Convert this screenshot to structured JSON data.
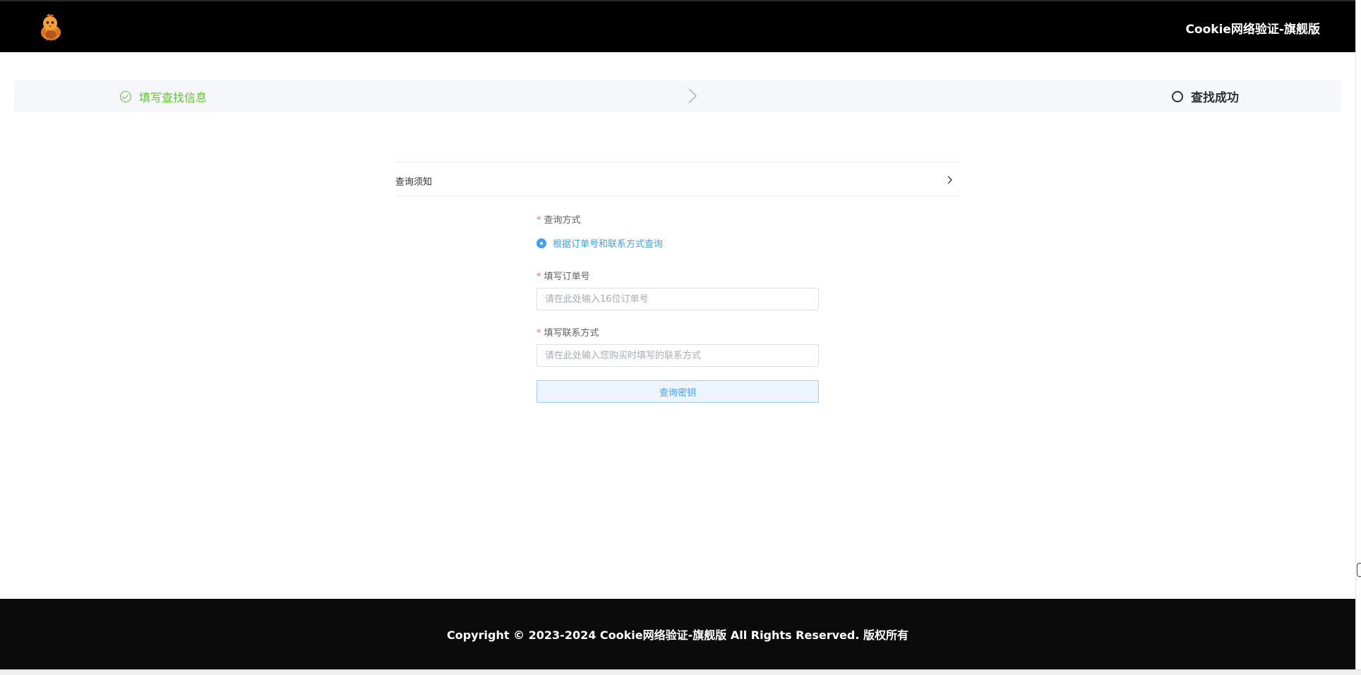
{
  "header": {
    "logo_icon": "chick-mascot-logo-icon",
    "title": "Cookie网络验证-旗舰版"
  },
  "steps": {
    "items": [
      {
        "label": "填写查找信息",
        "status": "done",
        "color": "#67c23a",
        "icon": "circle-check-icon"
      },
      {
        "label": "查找成功",
        "status": "pending",
        "color": "#303133",
        "icon": "circle-outline-icon"
      }
    ],
    "separator_icon": "chevron-right-icon"
  },
  "notice": {
    "title": "查询须知",
    "expand_icon": "chevron-right-icon"
  },
  "form": {
    "required_mark": "*",
    "query_method": {
      "label": "查询方式",
      "options": [
        "根据订单号和联系方式查询"
      ],
      "selected": "根据订单号和联系方式查询"
    },
    "order_no": {
      "label": "填写订单号",
      "value": "",
      "placeholder": "请在此处输入16位订单号"
    },
    "contact": {
      "label": "填写联系方式",
      "value": "",
      "placeholder": "请在此处输入您购买时填写的联系方式"
    },
    "submit_label": "查询密钥"
  },
  "footer": {
    "copyright": "Copyright © 2023-2024 Cookie网络验证-旗舰版 All Rights Reserved. 版权所有"
  },
  "colors": {
    "header_bg": "#000000",
    "footer_bg": "#0b0b0b",
    "success": "#67c23a",
    "primary": "#409eff",
    "required": "#f56c6c",
    "steps_bg": "#f5f7fa"
  }
}
